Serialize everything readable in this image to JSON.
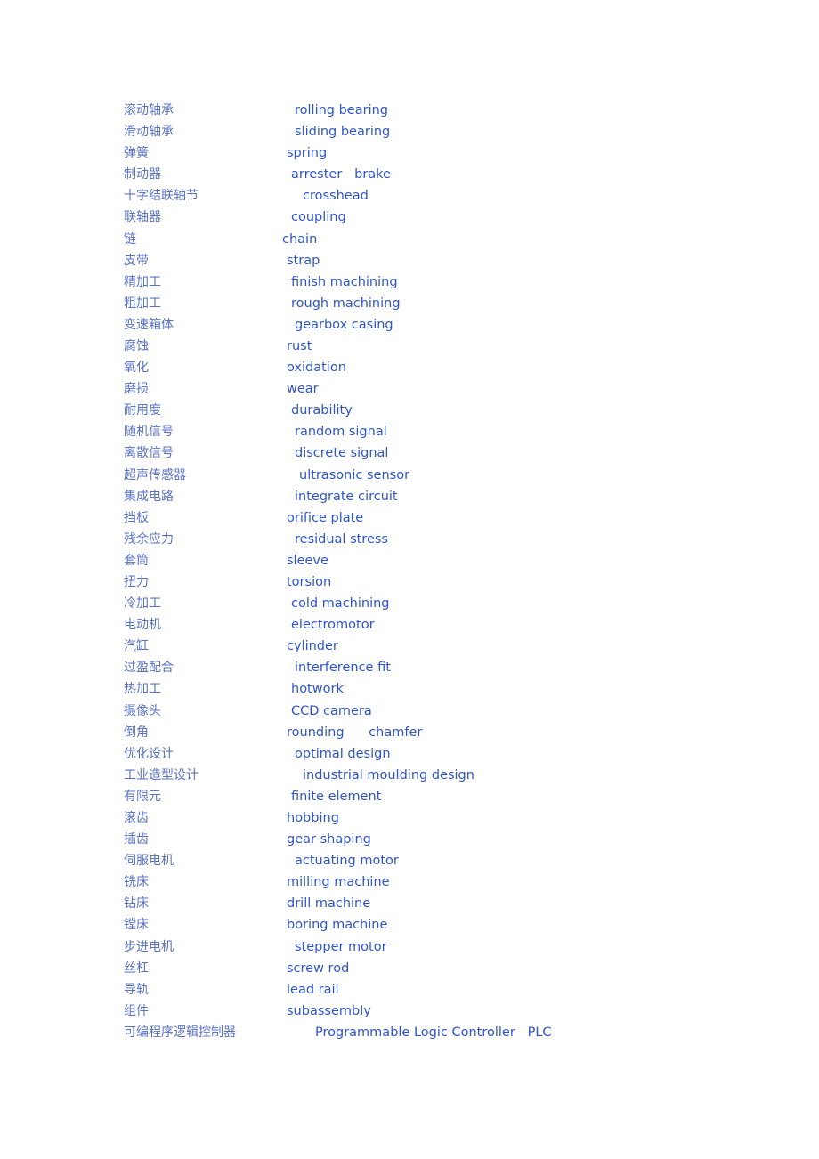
{
  "glossary": {
    "entries": [
      {
        "zh": "滚动轴承",
        "en": "rolling bearing"
      },
      {
        "zh": "滑动轴承",
        "en": "sliding bearing"
      },
      {
        "zh": "弹簧",
        "en": "spring"
      },
      {
        "zh": "制动器",
        "en": "arrester   brake"
      },
      {
        "zh": "十字结联轴节",
        "en": "crosshead"
      },
      {
        "zh": "联轴器",
        "en": "coupling"
      },
      {
        "zh": "链",
        "en": "chain"
      },
      {
        "zh": "皮带",
        "en": "strap"
      },
      {
        "zh": "精加工",
        "en": "finish machining"
      },
      {
        "zh": "粗加工",
        "en": "rough machining"
      },
      {
        "zh": "变速箱体",
        "en": "gearbox casing"
      },
      {
        "zh": "腐蚀",
        "en": "rust"
      },
      {
        "zh": "氧化",
        "en": "oxidation"
      },
      {
        "zh": "磨损",
        "en": "wear"
      },
      {
        "zh": "耐用度",
        "en": "durability"
      },
      {
        "zh": "随机信号",
        "en": "random signal"
      },
      {
        "zh": "离散信号",
        "en": "discrete signal"
      },
      {
        "zh": "超声传感器",
        "en": "ultrasonic sensor"
      },
      {
        "zh": "集成电路",
        "en": "integrate circuit"
      },
      {
        "zh": "挡板",
        "en": "orifice plate"
      },
      {
        "zh": "残余应力",
        "en": "residual stress"
      },
      {
        "zh": "套筒",
        "en": "sleeve"
      },
      {
        "zh": "扭力",
        "en": "torsion"
      },
      {
        "zh": "冷加工",
        "en": "cold machining"
      },
      {
        "zh": "电动机",
        "en": "electromotor"
      },
      {
        "zh": "汽缸",
        "en": "cylinder"
      },
      {
        "zh": "过盈配合",
        "en": "interference fit"
      },
      {
        "zh": "热加工",
        "en": "hotwork"
      },
      {
        "zh": "摄像头",
        "en": "CCD camera"
      },
      {
        "zh": "倒角",
        "en": "rounding      chamfer"
      },
      {
        "zh": "优化设计",
        "en": "optimal design"
      },
      {
        "zh": "工业造型设计",
        "en": "industrial moulding design"
      },
      {
        "zh": "有限元",
        "en": "finite element"
      },
      {
        "zh": "滚齿",
        "en": "hobbing"
      },
      {
        "zh": "插齿",
        "en": "gear shaping"
      },
      {
        "zh": "伺服电机",
        "en": "actuating motor"
      },
      {
        "zh": "铣床",
        "en": "milling machine"
      },
      {
        "zh": "钻床",
        "en": "drill machine"
      },
      {
        "zh": "镗床",
        "en": "boring machine"
      },
      {
        "zh": "步进电机",
        "en": "stepper motor"
      },
      {
        "zh": "丝杠",
        "en": "screw rod"
      },
      {
        "zh": "导轨",
        "en": "lead rail"
      },
      {
        "zh": "组件",
        "en": "subassembly"
      },
      {
        "zh": "可编程序逻辑控制器",
        "en": "Programmable Logic Controller   PLC"
      }
    ]
  }
}
